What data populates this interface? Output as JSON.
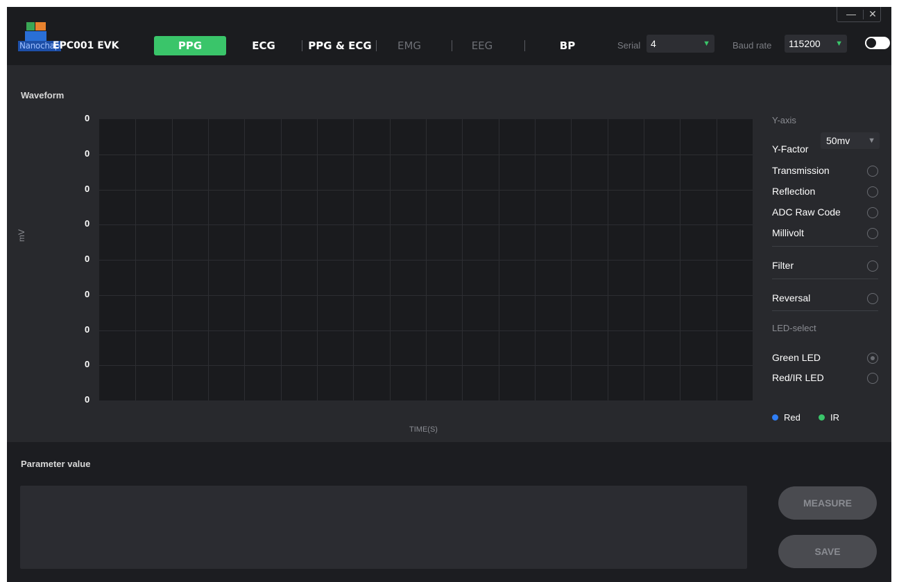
{
  "brand": {
    "logo_text": "Nanochap",
    "product": "EPC001 EVK"
  },
  "tabs": [
    {
      "label": "PPG",
      "state": "active"
    },
    {
      "label": "ECG",
      "state": "normal"
    },
    {
      "label": "PPG & ECG",
      "state": "normal"
    },
    {
      "label": "EMG",
      "state": "disabled"
    },
    {
      "label": "EEG",
      "state": "disabled"
    },
    {
      "label": "BP",
      "state": "normal"
    }
  ],
  "connection": {
    "serial_label": "Serial",
    "serial_value": "4",
    "baud_label": "Baud rate",
    "baud_value": "115200",
    "toggle_on": false
  },
  "window": {
    "minimize": "—",
    "close": "✕"
  },
  "waveform": {
    "title": "Waveform",
    "y_ticks": [
      "0",
      "0",
      "0",
      "0",
      "0",
      "0",
      "0",
      "0",
      "0"
    ],
    "ylabel": "mV",
    "xlabel": "TIME(S)"
  },
  "right_panel": {
    "yaxis_header": "Y-axis",
    "yfactor_label": "Y-Factor",
    "yfactor_value": "50mv",
    "options": [
      {
        "label": "Transmission",
        "selected": false
      },
      {
        "label": "Reflection",
        "selected": false
      },
      {
        "label": "ADC Raw Code",
        "selected": false
      },
      {
        "label": "Millivolt",
        "selected": false
      }
    ],
    "filter_label": "Filter",
    "reversal_label": "Reversal",
    "led_header": "LED-select",
    "leds": [
      {
        "label": "Green LED",
        "selected": true
      },
      {
        "label": "Red/IR LED",
        "selected": false
      }
    ],
    "legend": [
      {
        "label": "Red",
        "color": "#2f7ef5"
      },
      {
        "label": "IR",
        "color": "#3ac56a"
      }
    ]
  },
  "parameters": {
    "title": "Parameter value",
    "measure_label": "MEASURE",
    "save_label": "SAVE"
  },
  "colors": {
    "accent": "#3ac56a",
    "background": "#1c1d21",
    "panel": "#28292d",
    "plot": "#1a1b1e"
  }
}
